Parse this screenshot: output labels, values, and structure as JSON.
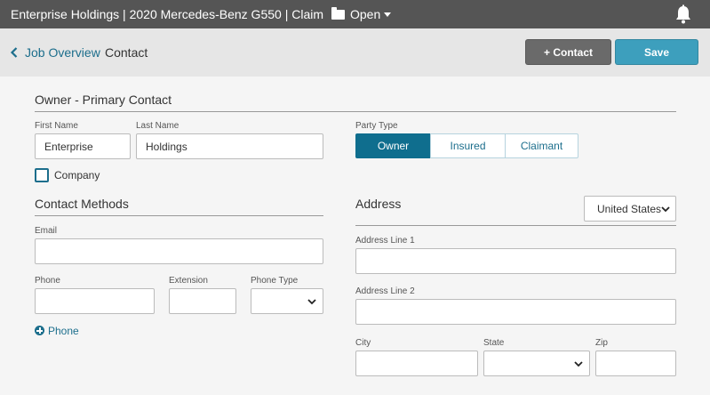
{
  "header": {
    "title": "Enterprise Holdings | 2020 Mercedes-Benz G550 | Claim",
    "status": "Open",
    "icons": {
      "folder": "folder-icon",
      "caret": "caret-down-icon",
      "bell": "bell-icon"
    }
  },
  "breadcrumb": {
    "back_icon": "chevron-left-icon",
    "link": "Job Overview",
    "current": "Contact"
  },
  "toolbar": {
    "add_contact_label": "+ Contact",
    "save_label": "Save"
  },
  "owner": {
    "section_title": "Owner - Primary Contact",
    "first_name_label": "First Name",
    "first_name_value": "Enterprise",
    "last_name_label": "Last Name",
    "last_name_value": "Holdings",
    "party_type_label": "Party Type",
    "party_types": [
      "Owner",
      "Insured",
      "Claimant"
    ],
    "selected_party_type": "Owner",
    "company_label": "Company",
    "company_checked": false
  },
  "contact_methods": {
    "section_title": "Contact Methods",
    "email_label": "Email",
    "email_value": "",
    "phone_label": "Phone",
    "phone_value": "",
    "extension_label": "Extension",
    "extension_value": "",
    "phone_type_label": "Phone Type",
    "phone_type_value": "",
    "add_phone_label": "Phone"
  },
  "address": {
    "section_title": "Address",
    "country_value": "United States",
    "line1_label": "Address Line 1",
    "line1_value": "",
    "line2_label": "Address Line 2",
    "line2_value": "",
    "city_label": "City",
    "city_value": "",
    "state_label": "State",
    "state_value": "",
    "zip_label": "Zip",
    "zip_value": ""
  },
  "colors": {
    "topbar": "#555555",
    "accent": "#1c6e8c",
    "save_button": "#3d9fbd",
    "contact_button": "#6a6a6a",
    "active_segment": "#0f6e8e"
  }
}
